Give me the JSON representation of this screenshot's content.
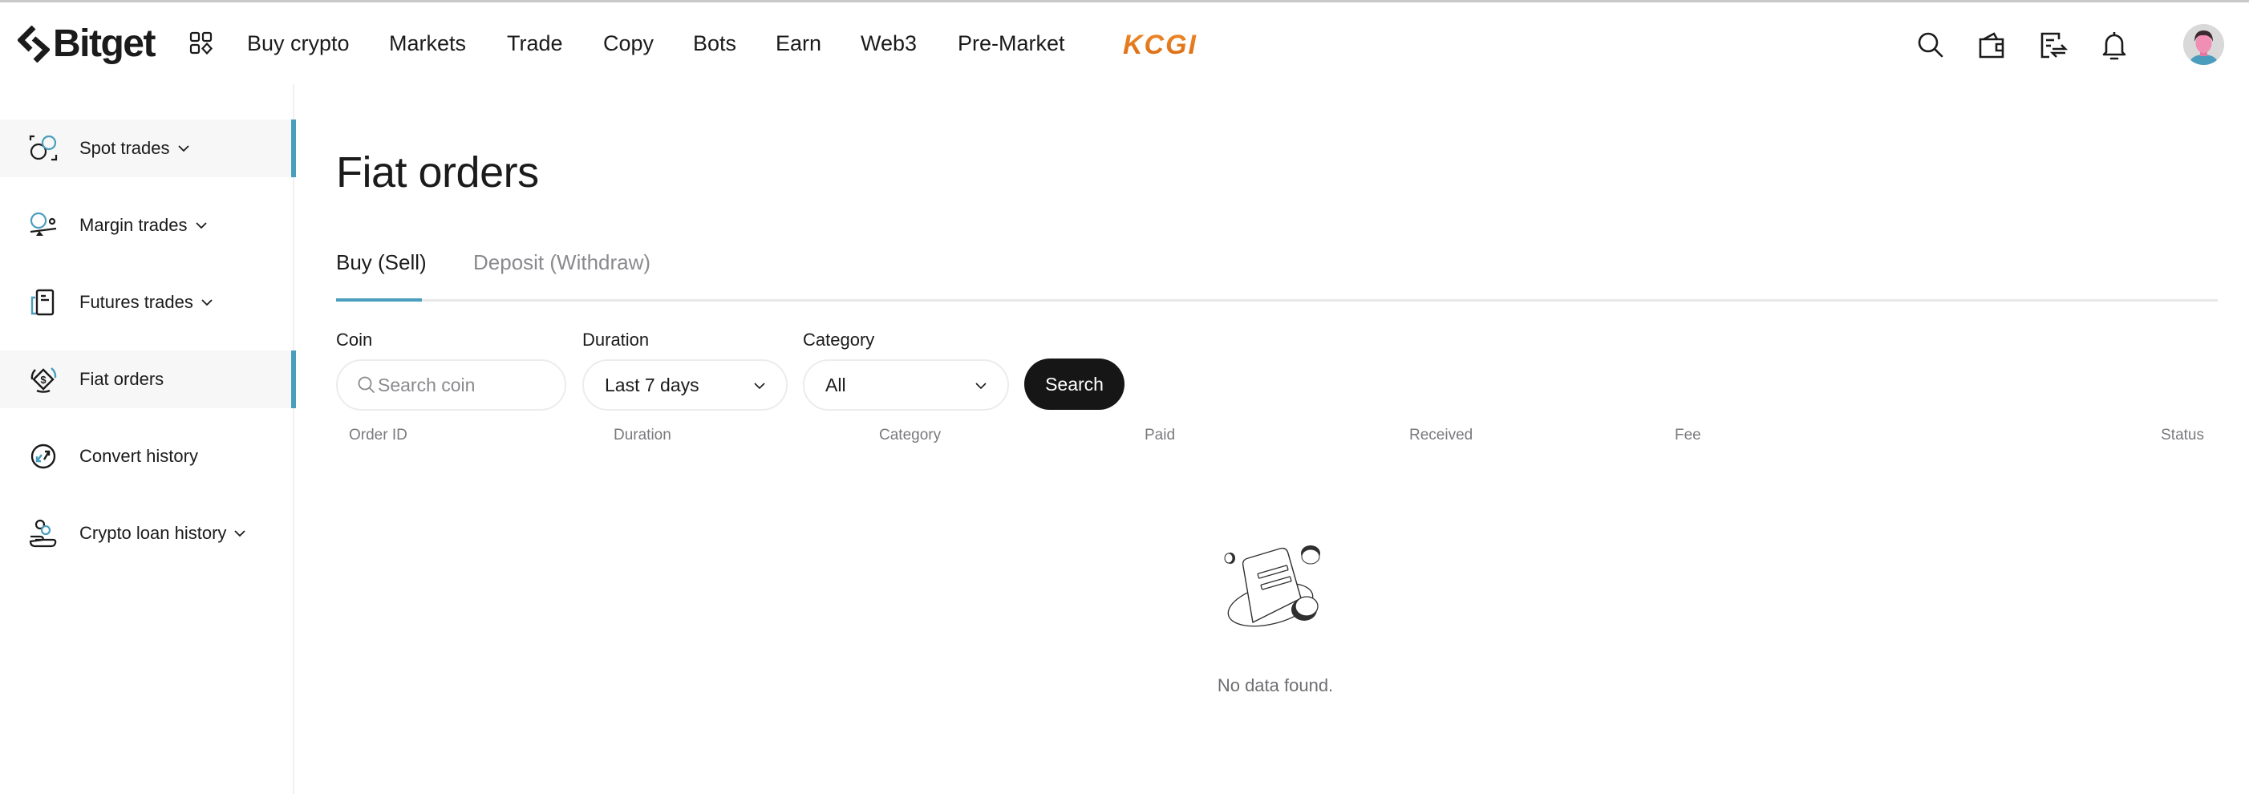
{
  "header": {
    "brand": "Bitget",
    "nav": [
      {
        "label": "Buy crypto"
      },
      {
        "label": "Markets"
      },
      {
        "label": "Trade"
      },
      {
        "label": "Copy"
      },
      {
        "label": "Bots"
      },
      {
        "label": "Earn"
      },
      {
        "label": "Web3"
      },
      {
        "label": "Pre-Market"
      }
    ],
    "promo_logo": "KCGI",
    "icons": [
      "search-icon",
      "wallet-icon",
      "orders-icon",
      "bell-icon",
      "avatar"
    ]
  },
  "sidebar": {
    "items": [
      {
        "label": "Spot trades",
        "has_dropdown": true,
        "active": true,
        "icon": "spot-trades-icon"
      },
      {
        "label": "Margin trades",
        "has_dropdown": true,
        "active": false,
        "icon": "margin-trades-icon"
      },
      {
        "label": "Futures trades",
        "has_dropdown": true,
        "active": false,
        "icon": "futures-trades-icon"
      },
      {
        "label": "Fiat orders",
        "has_dropdown": false,
        "active": true,
        "icon": "fiat-orders-icon"
      },
      {
        "label": "Convert history",
        "has_dropdown": false,
        "active": false,
        "icon": "convert-history-icon"
      },
      {
        "label": "Crypto loan history",
        "has_dropdown": true,
        "active": false,
        "icon": "crypto-loan-icon"
      }
    ]
  },
  "main": {
    "title": "Fiat orders",
    "tabs": [
      {
        "label": "Buy (Sell)",
        "active": true
      },
      {
        "label": "Deposit (Withdraw)",
        "active": false
      }
    ],
    "filters": {
      "coin": {
        "label": "Coin",
        "placeholder": "Search coin",
        "value": ""
      },
      "duration": {
        "label": "Duration",
        "value": "Last 7 days"
      },
      "category": {
        "label": "Category",
        "value": "All"
      },
      "search_button": "Search"
    },
    "table": {
      "columns": [
        "Order ID",
        "Duration",
        "Category",
        "Paid",
        "Received",
        "Fee",
        "Status"
      ],
      "rows": []
    },
    "empty_message": "No data found."
  },
  "colors": {
    "accent": "#4a9dbd",
    "text": "#1b1b1c",
    "muted": "#8a8a8e",
    "button_bg": "#161617",
    "promo": "#e67e22"
  }
}
